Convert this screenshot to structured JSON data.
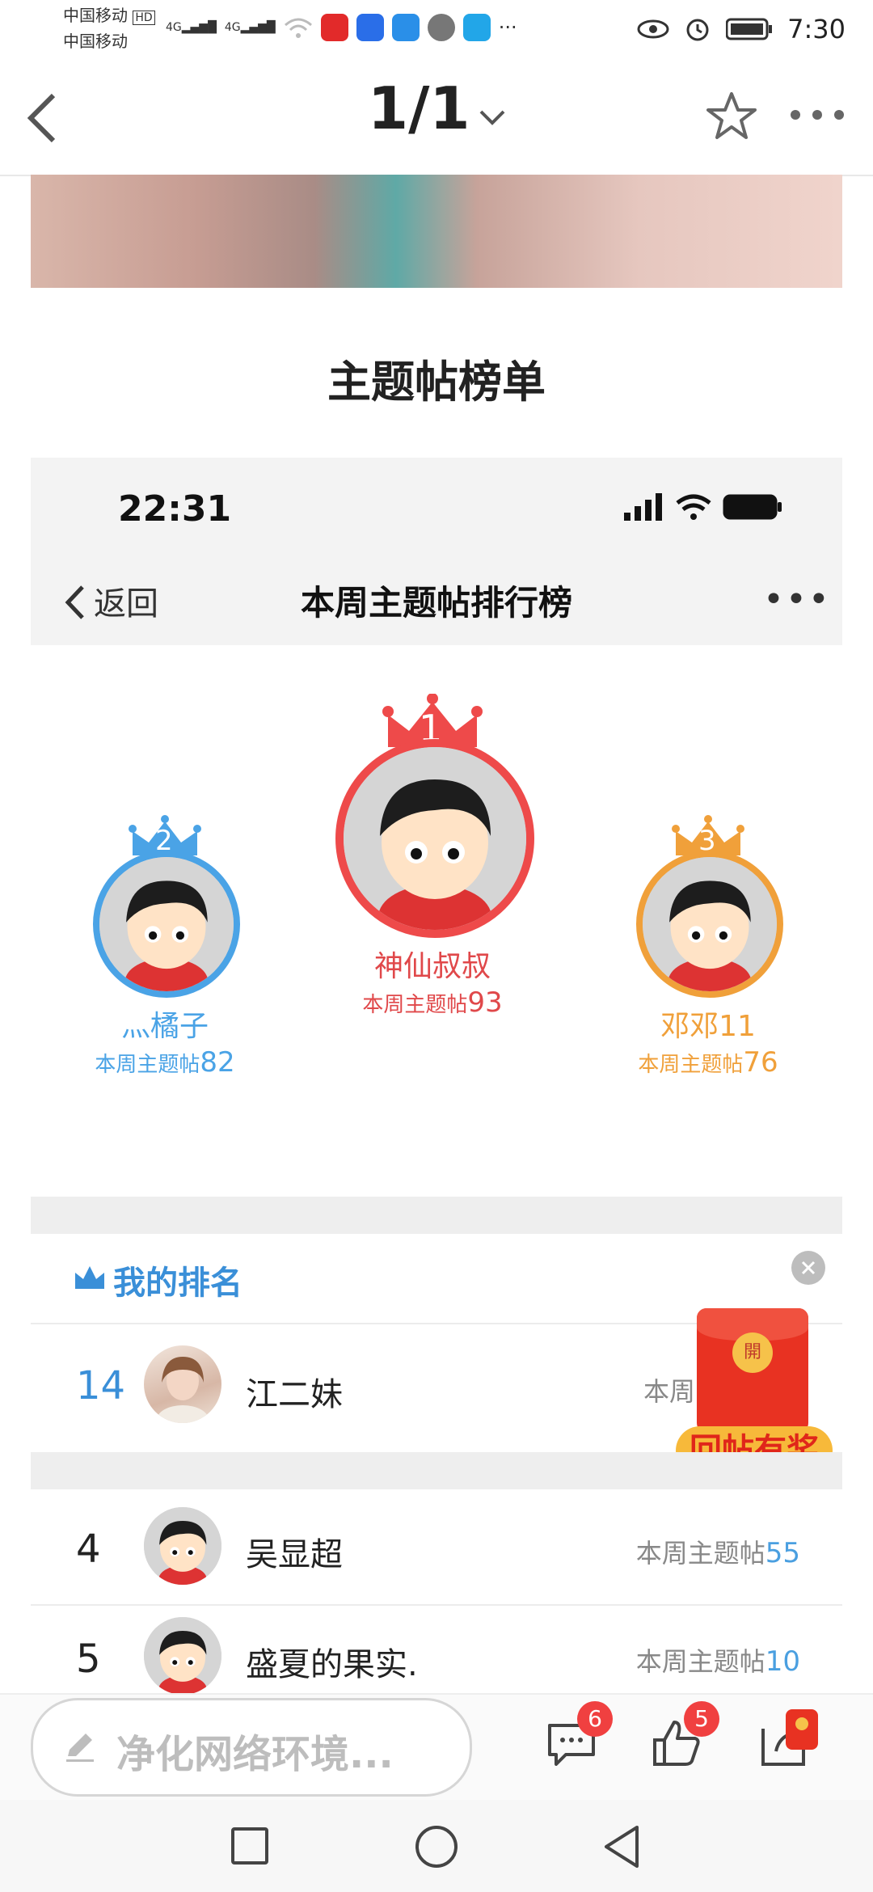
{
  "status_bar": {
    "carrier1": "中国移动",
    "carrier1_hd": "HD",
    "carrier2": "中国移动",
    "signal1": "4G",
    "signal2": "4G",
    "more": "···",
    "time": "7:30"
  },
  "app_nav": {
    "page_indicator": "1/1",
    "icons": [
      "back-chevron-icon",
      "chevron-down-icon",
      "star-icon",
      "more-dots-icon"
    ]
  },
  "section_title": "主题帖榜单",
  "embedded": {
    "time": "22:31",
    "back_label": "返回",
    "title": "本周主题帖排行榜",
    "more": "•••",
    "podium": [
      {
        "rank": "1",
        "name": "神仙叔叔",
        "label": "本周主题帖",
        "count": "93",
        "color": "#ee4a4a"
      },
      {
        "rank": "2",
        "name": "灬橘子",
        "label": "本周主题帖",
        "count": "82",
        "color": "#4aa3e6"
      },
      {
        "rank": "3",
        "name": "邓邓11",
        "label": "本周主题帖",
        "count": "76",
        "color": "#f0a03a"
      }
    ],
    "my_rank": {
      "title": "我的排名",
      "rank": "14",
      "name": "江二妹",
      "label_partial": "本周"
    },
    "redpacket": {
      "seal": "開",
      "label": "回帖有奖"
    },
    "list": [
      {
        "rank": "4",
        "name": "吴显超",
        "label": "本周主题帖",
        "count": "55"
      },
      {
        "rank": "5",
        "name": "盛夏的果实.",
        "label": "本周主题帖",
        "count": "10"
      }
    ]
  },
  "bottom_bar": {
    "input_placeholder": "净化网络环境...",
    "comment_badge": "6",
    "like_badge": "5"
  },
  "colors": {
    "gold": "#f0a03a",
    "blue": "#4aa3e6",
    "red": "#ee4a4a"
  }
}
